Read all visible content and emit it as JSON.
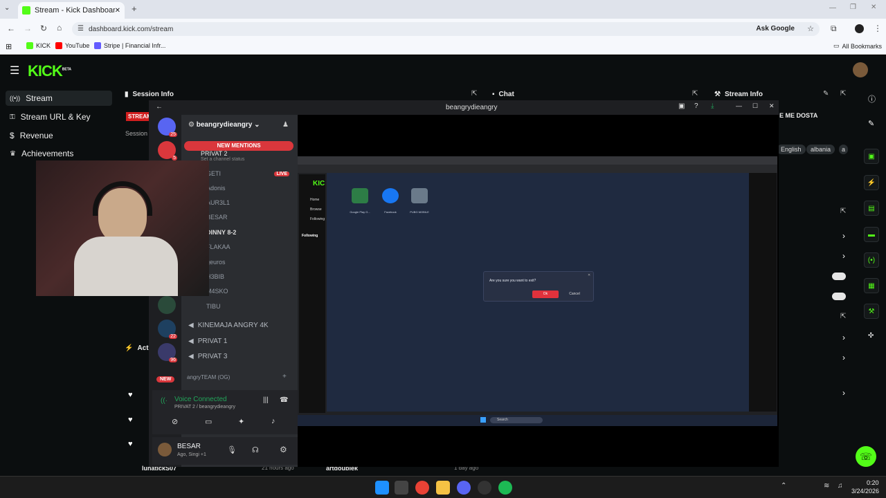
{
  "browser": {
    "tab_title": "Stream - Kick Dashboard",
    "url": "dashboard.kick.com/stream",
    "ask_google": "Ask Google",
    "bookmarks": [
      "KICK",
      "YouTube",
      "Stripe | Financial Infr..."
    ],
    "all_bookmarks": "All Bookmarks"
  },
  "kick": {
    "logo": "KICK",
    "logo_badge": "BETA",
    "sidebar": [
      {
        "label": "Stream",
        "icon": "signal-icon"
      },
      {
        "label": "Stream URL & Key",
        "icon": "key-icon"
      },
      {
        "label": "Revenue",
        "icon": "dollar-icon"
      },
      {
        "label": "Achievements",
        "icon": "trophy-icon"
      }
    ],
    "panels": {
      "session_info": "Session Info",
      "chat": "Chat",
      "stream_info": "Stream Info",
      "activity": "Acti"
    },
    "session_status": "STREAM",
    "session_label": "Session",
    "stream_title_fragment": "E ME DOSTA",
    "tags": [
      "English",
      "albania",
      "a"
    ],
    "activity_rows": [
      {
        "name": "lunatickS07",
        "time": "21 hours ago"
      }
    ],
    "chat_bottom": {
      "name": "artdoublek",
      "time": "1 day ago"
    }
  },
  "discord": {
    "window_title": "beangrydieangry",
    "server_name": "beangrydieangry",
    "new_mentions": "NEW MENTIONS",
    "set_status": "Set a channel status",
    "current_channel": "PRIVAT 2",
    "members": [
      "GETI",
      "Adonis",
      "AUR3L1",
      "BESAR",
      "DINNY 8-2",
      "FLAKAA",
      "geuros",
      "H3BIB",
      "M4SKO",
      "TIBU"
    ],
    "live_label": "LIVE",
    "voice_channels": [
      "KINEMAJA ANGRY 4K",
      "PRIVAT 1",
      "PRIVAT 3"
    ],
    "category": "angryTEAM (OG)",
    "voice_status": "Voice Connected",
    "voice_sub": "PRIVAT 2 / beangrydieangry",
    "user_name": "BESAR",
    "user_status": "Ago, Singi +1",
    "guild_badges": [
      "25",
      "5",
      "22",
      "96"
    ],
    "new_label": "NEW"
  },
  "shared_screen": {
    "desktop_icons": [
      "Google Play G...",
      "Facebook",
      "PUBG MOBILE"
    ],
    "dialog_text": "Are you sure you want to exit?",
    "dialog_ok": "Ok",
    "dialog_cancel": "Cancel",
    "inner_sidebar": [
      "Home",
      "Browse",
      "Following"
    ],
    "inner_following": "Following",
    "search": "Search"
  },
  "taskbar": {
    "time": "0:20",
    "date": "3/24/2026"
  }
}
